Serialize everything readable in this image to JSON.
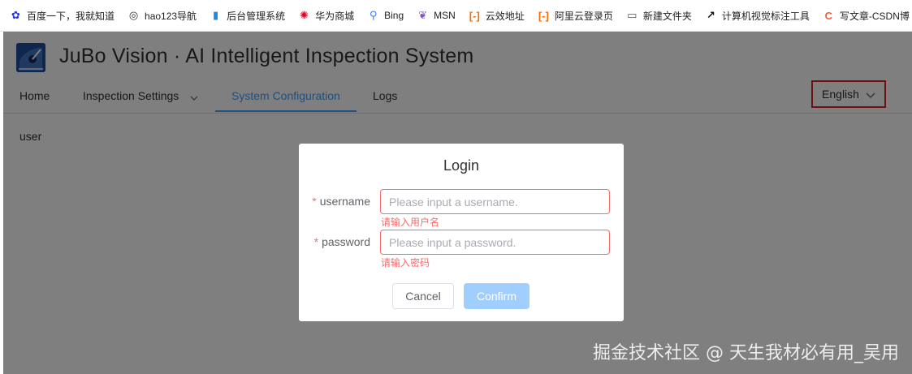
{
  "bookmarks": [
    {
      "label": "百度一下，我就知道",
      "icon": "baidu-paw-icon",
      "color": "#2932e1"
    },
    {
      "label": "hao123导航",
      "icon": "globe-icon",
      "color": "#333333"
    },
    {
      "label": "后台管理系统",
      "icon": "admin-panel-icon",
      "color": "#1e88e5"
    },
    {
      "label": "华为商城",
      "icon": "huawei-logo-icon",
      "color": "#cf0a2c"
    },
    {
      "label": "Bing",
      "icon": "search-icon",
      "color": "#3b82f6"
    },
    {
      "label": "MSN",
      "icon": "msn-butterfly-icon",
      "color": "#7e57c2"
    },
    {
      "label": "云效地址",
      "icon": "aliyun-icon",
      "color": "#ff6a00"
    },
    {
      "label": "阿里云登录页",
      "icon": "aliyun-icon",
      "color": "#ff6a00"
    },
    {
      "label": "新建文件夹",
      "icon": "folder-icon",
      "color": "#555555"
    },
    {
      "label": "计算机视觉标注工具",
      "icon": "arrow-circle-icon",
      "color": "#111111"
    },
    {
      "label": "写文章-CSDN博",
      "icon": "csdn-icon",
      "color": "#fc5531"
    }
  ],
  "app": {
    "title": "JuBo Vision · AI Intelligent Inspection System",
    "nav": {
      "home": "Home",
      "inspection_settings": "Inspection Settings",
      "system_configuration": "System Configuration",
      "logs": "Logs"
    },
    "language": "English",
    "content_text": "user"
  },
  "login": {
    "title": "Login",
    "username_label": "username",
    "username_placeholder": "Please input a username.",
    "username_error": "请输入用户名",
    "password_label": "password",
    "password_placeholder": "Please input a password.",
    "password_error": "请输入密码",
    "required_mark": "*",
    "cancel_label": "Cancel",
    "confirm_label": "Confirm"
  },
  "watermark": "掘金技术社区 @ 天生我材必有用_吴用",
  "colors": {
    "accent": "#409eff",
    "error": "#f56c6c",
    "highlight_box": "#e02020",
    "confirm_disabled": "#a0cfff"
  }
}
